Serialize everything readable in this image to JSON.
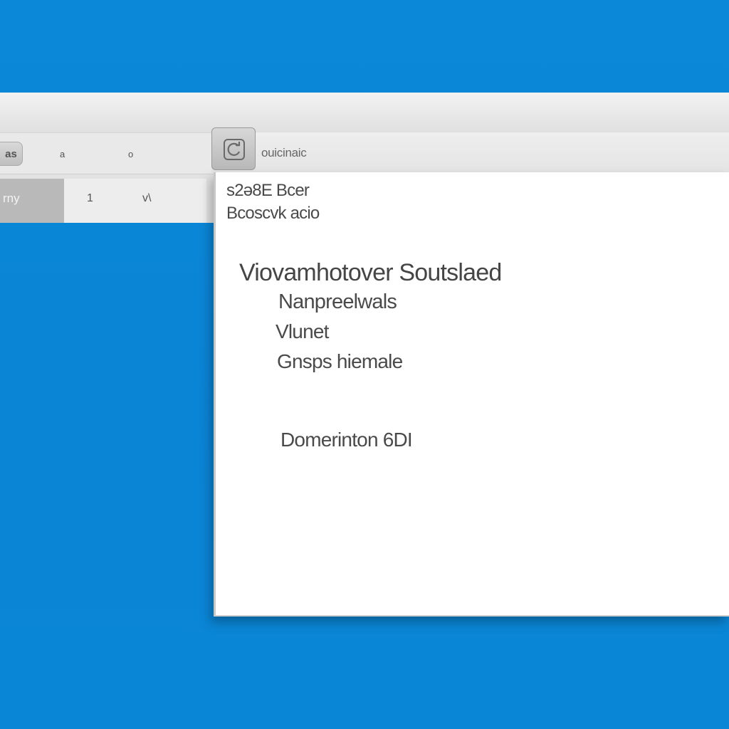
{
  "background_window": {
    "app_icon_label": "as",
    "toolbar": {
      "tool_1": "a",
      "tool_2": "o"
    },
    "tabs": [
      {
        "label": "rny"
      },
      {
        "label": "1",
        "extra": "v\\"
      }
    ]
  },
  "document_window": {
    "title": "ouicinaic",
    "lines": {
      "address_line_1": "s2ə8E Bcer",
      "address_line_2": "Bcoscvk acio",
      "greeting": "Viovamhotover Soutslaed",
      "body_line_1": "Nanpreelwals",
      "body_line_2": "Vlunet",
      "body_line_3": "Gnsps hiemale",
      "closing": "Domerinton  6DI"
    }
  },
  "colors": {
    "desktop": "#0a86d6",
    "window": "#ffffff",
    "chrome": "#e6e6e6",
    "text": "#4a4a4a"
  }
}
